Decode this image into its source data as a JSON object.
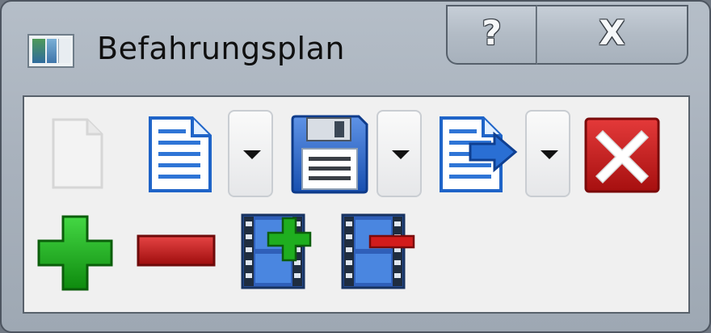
{
  "window": {
    "title": "Befahrungsplan",
    "help_glyph": "?",
    "close_glyph": "X"
  },
  "toolbar": {
    "row1": [
      {
        "name": "new-document-icon",
        "enabled": false
      },
      {
        "name": "open-document-icon",
        "enabled": true,
        "has_dropdown": true
      },
      {
        "name": "save-floppy-icon",
        "enabled": true,
        "has_dropdown": true
      },
      {
        "name": "export-document-icon",
        "enabled": true,
        "has_dropdown": true
      },
      {
        "name": "delete-red-x-icon",
        "enabled": true
      }
    ],
    "row2": [
      {
        "name": "add-green-plus-icon",
        "enabled": true
      },
      {
        "name": "remove-red-minus-icon",
        "enabled": true
      },
      {
        "name": "add-film-icon",
        "enabled": true
      },
      {
        "name": "remove-film-icon",
        "enabled": true
      }
    ]
  },
  "colors": {
    "frame": "#a9b2bd",
    "toolbar_bg": "#f0f0f0",
    "accent_blue": "#2f6fd0",
    "accent_green": "#1faa1f",
    "accent_red": "#c71c1c"
  }
}
